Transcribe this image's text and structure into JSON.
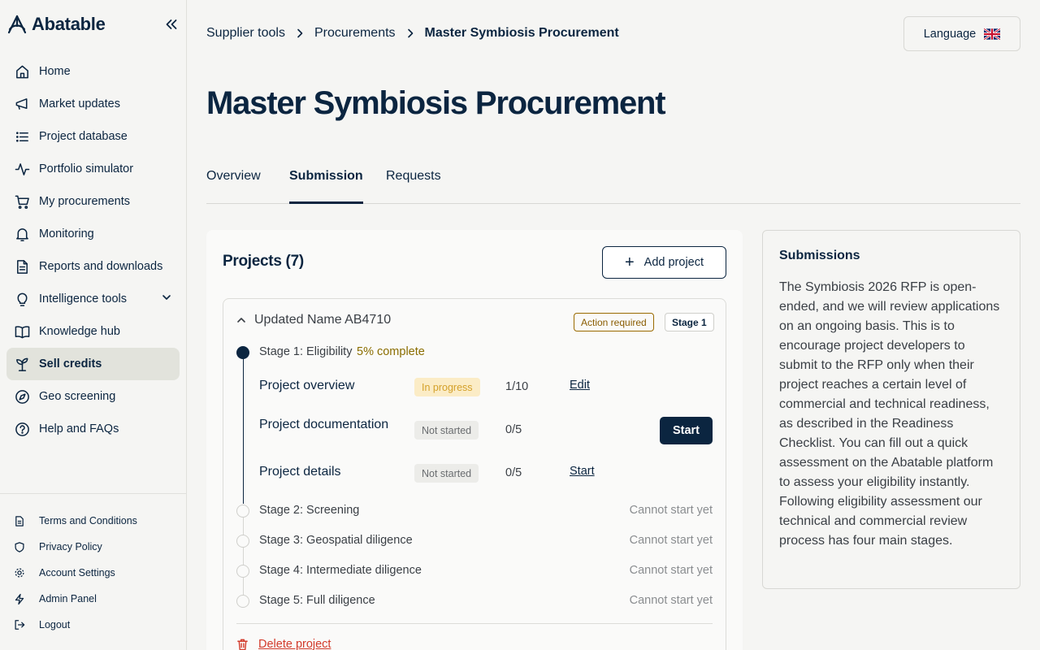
{
  "brand": {
    "name": "Abatable"
  },
  "sidebar": {
    "items": [
      {
        "label": "Home",
        "icon": "home-icon"
      },
      {
        "label": "Market updates",
        "icon": "megaphone-icon"
      },
      {
        "label": "Project database",
        "icon": "list-icon"
      },
      {
        "label": "Portfolio simulator",
        "icon": "activity-icon"
      },
      {
        "label": "My procurements",
        "icon": "cart-icon"
      },
      {
        "label": "Monitoring",
        "icon": "bell-icon"
      },
      {
        "label": "Reports and downloads",
        "icon": "document-icon"
      },
      {
        "label": "Intelligence tools",
        "icon": "lightbulb-icon"
      },
      {
        "label": "Knowledge hub",
        "icon": "book-icon"
      },
      {
        "label": "Sell credits",
        "icon": "sprout-icon",
        "active": true
      },
      {
        "label": "Geo screening",
        "icon": "compass-icon"
      },
      {
        "label": "Help and FAQs",
        "icon": "help-icon"
      }
    ],
    "footer": [
      {
        "label": "Terms and Conditions",
        "icon": "document-icon"
      },
      {
        "label": "Privacy Policy",
        "icon": "shield-icon"
      },
      {
        "label": "Account Settings",
        "icon": "gear-icon"
      },
      {
        "label": "Admin Panel",
        "icon": "bolt-icon"
      },
      {
        "label": "Logout",
        "icon": "logout-icon"
      }
    ]
  },
  "header": {
    "breadcrumb": [
      "Supplier tools",
      "Procurements",
      "Master Symbiosis Procurement"
    ],
    "language_label": "Language"
  },
  "page": {
    "title": "Master Symbiosis Procurement",
    "tabs": [
      "Overview",
      "Submission",
      "Requests"
    ],
    "active_tab": "Submission"
  },
  "projects": {
    "title": "Projects (7)",
    "add_label": "Add project",
    "project": {
      "name": "Updated Name AB4710",
      "badge_action": "Action required",
      "badge_stage": "Stage 1",
      "stage1": {
        "label": "Stage 1: Eligibility",
        "progress": "5% complete"
      },
      "tasks": [
        {
          "name": "Project overview",
          "status": "In progress",
          "count": "1/10",
          "action": "Edit"
        },
        {
          "name": "Project documentation",
          "status": "Not started",
          "count": "0/5",
          "action": "Start"
        },
        {
          "name": "Project details",
          "status": "Not started",
          "count": "0/5",
          "action": "Start"
        }
      ],
      "stages": [
        {
          "label": "Stage 2: Screening",
          "status": "Cannot start yet"
        },
        {
          "label": "Stage 3: Geospatial diligence",
          "status": "Cannot start yet"
        },
        {
          "label": "Stage 4: Intermediate diligence",
          "status": "Cannot start yet"
        },
        {
          "label": "Stage 5: Full diligence",
          "status": "Cannot start yet"
        }
      ],
      "delete_label": "Delete project"
    }
  },
  "submissions": {
    "title": "Submissions",
    "body": "The Symbiosis 2026 RFP is open-ended, and we will review applications on an ongoing basis. This is to encourage project developers to submit to the RFP only when their project reaches a certain level of commercial and technical readiness, as described in the Readiness Checklist. You can fill out a quick assessment on the Abatable platform to assess your eligibility instantly. Following eligibility assessment our technical and commercial review process has four main stages."
  },
  "colors": {
    "navy": "#0b2540",
    "amber": "#8a6d00",
    "danger": "#d23a2a",
    "active_bg": "#e2e3dc"
  }
}
